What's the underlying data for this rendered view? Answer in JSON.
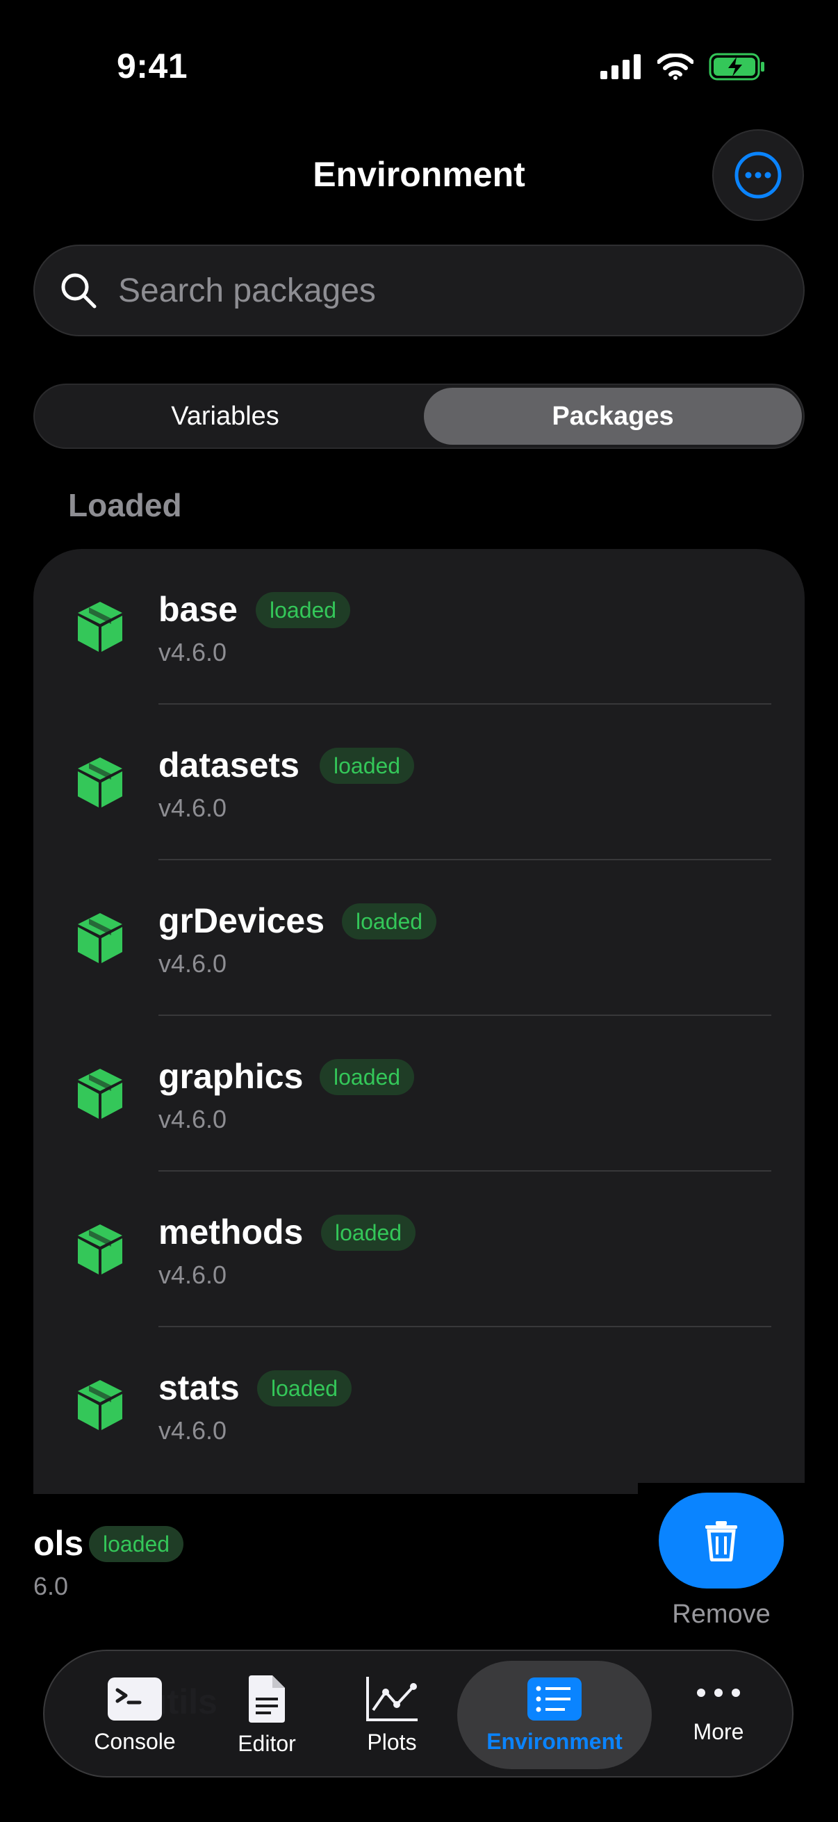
{
  "status_bar": {
    "time": "9:41"
  },
  "header": {
    "title": "Environment"
  },
  "search": {
    "placeholder": "Search packages"
  },
  "segments": {
    "left": "Variables",
    "right": "Packages"
  },
  "section": {
    "title": "Loaded"
  },
  "packages": [
    {
      "name": "base",
      "badge": "loaded",
      "version": "v4.6.0"
    },
    {
      "name": "datasets",
      "badge": "loaded",
      "version": "v4.6.0"
    },
    {
      "name": "grDevices",
      "badge": "loaded",
      "version": "v4.6.0"
    },
    {
      "name": "graphics",
      "badge": "loaded",
      "version": "v4.6.0"
    },
    {
      "name": "methods",
      "badge": "loaded",
      "version": "v4.6.0"
    },
    {
      "name": "stats",
      "badge": "loaded",
      "version": "v4.6.0"
    }
  ],
  "swiped_row": {
    "name": "ols",
    "badge": "loaded",
    "version": "6.0"
  },
  "remove": {
    "label": "Remove"
  },
  "ghost_row": {
    "name": "utils"
  },
  "tabs": [
    {
      "label": "Console",
      "icon": "terminal-icon"
    },
    {
      "label": "Editor",
      "icon": "document-icon"
    },
    {
      "label": "Plots",
      "icon": "line-chart-icon"
    },
    {
      "label": "Environment",
      "icon": "list-icon"
    },
    {
      "label": "More",
      "icon": "ellipsis-icon"
    }
  ],
  "colors": {
    "accent": "#0a84ff",
    "package_green": "#34c759",
    "badge_bg": "#1f3d26"
  }
}
